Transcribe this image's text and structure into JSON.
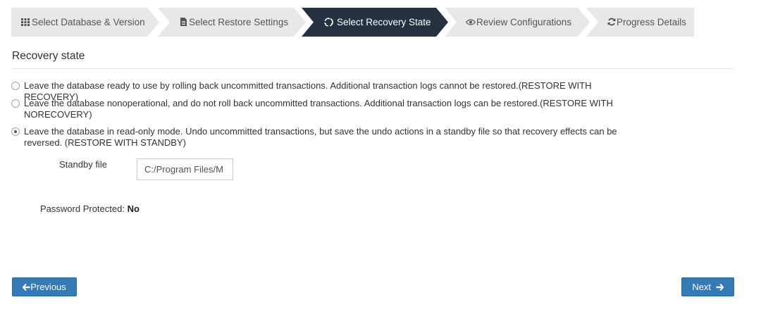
{
  "wizard": {
    "steps": [
      {
        "label": "Select Database & Version",
        "icon": "grid-icon",
        "active": false
      },
      {
        "label": "Select Restore Settings",
        "icon": "document-icon",
        "active": false
      },
      {
        "label": "Select Recovery State",
        "icon": "recycle-icon",
        "active": true
      },
      {
        "label": "Review Configurations",
        "icon": "eye-icon",
        "active": false
      },
      {
        "label": "Progress Details",
        "icon": "refresh-icon",
        "active": false
      }
    ],
    "active_color": "#253140",
    "inactive_color": "#e8e8e8"
  },
  "section": {
    "title": "Recovery state"
  },
  "options": [
    {
      "text": "Leave the database ready to use by rolling back uncommitted transactions. Additional transaction logs cannot be restored.(RESTORE WITH RECOVERY)",
      "checked": false
    },
    {
      "text": "Leave the database nonoperational, and do not roll back uncommitted transactions. Additional transaction logs can be restored.(RESTORE WITH NORECOVERY)",
      "checked": false
    },
    {
      "text": "Leave the database in read-only mode. Undo uncommitted transactions, but save the undo actions in a standby file so that recovery effects can be reversed. (RESTORE WITH STANDBY)",
      "checked": true
    }
  ],
  "standby": {
    "label": "Standby file",
    "value": "C:/Program Files/M"
  },
  "password": {
    "label": "Password Protected:",
    "value": "No"
  },
  "buttons": {
    "previous": "Previous",
    "next": "Next",
    "color": "#337ab7"
  }
}
